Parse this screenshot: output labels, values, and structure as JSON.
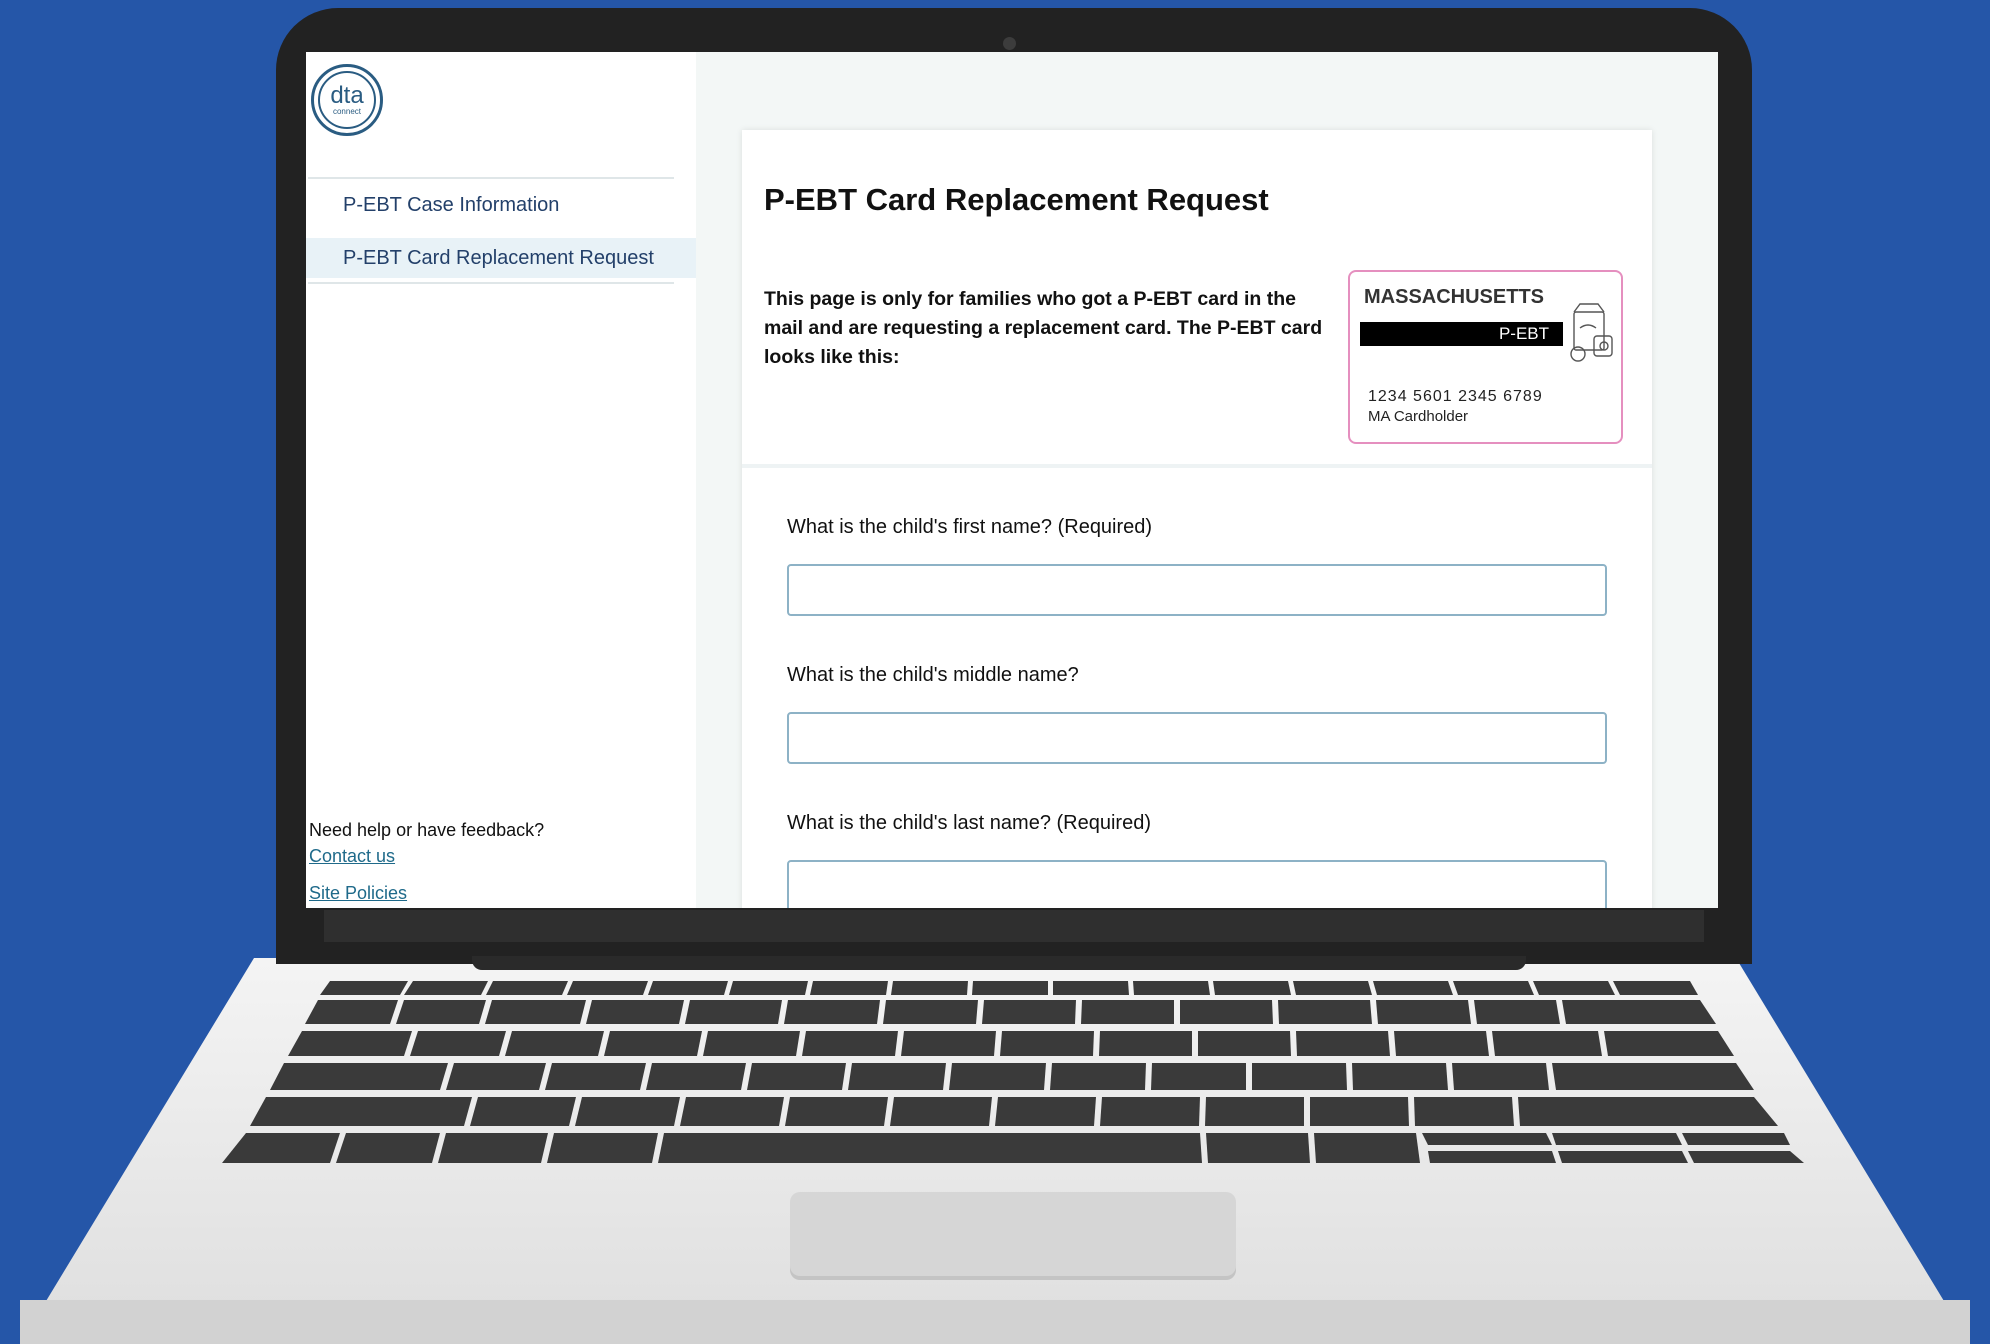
{
  "logo": {
    "main": "dta",
    "sub": "connect"
  },
  "sidebar": {
    "items": [
      {
        "label": "P-EBT Case Information"
      },
      {
        "label": "P-EBT Card Replacement Request"
      }
    ],
    "help_text": "Need help or have feedback?",
    "contact_link": "Contact us",
    "policies_link": "Site Policies"
  },
  "main": {
    "title": "P-EBT Card Replacement Request",
    "intro": "This page is only for families who got a P-EBT card in the mail and are requesting a replacement card. The P-EBT card looks like this:",
    "card_image": {
      "state": "MASSACHUSETTS",
      "program": "P-EBT",
      "number": "1234 5601 2345 6789",
      "holder": "MA Cardholder",
      "icon": "lunch-bag-icon"
    },
    "questions": [
      {
        "label": "What is the child's first name? (Required)",
        "value": ""
      },
      {
        "label": "What is the child's middle name?",
        "value": ""
      },
      {
        "label": "What is the child's last name? (Required)",
        "value": ""
      }
    ]
  },
  "colors": {
    "background": "#2556a8",
    "nav_text": "#23406a",
    "nav_active_bg": "#e8f2f7",
    "link": "#1f6a8a",
    "input_border": "#8db2c6",
    "card_border": "#e58fbf"
  }
}
